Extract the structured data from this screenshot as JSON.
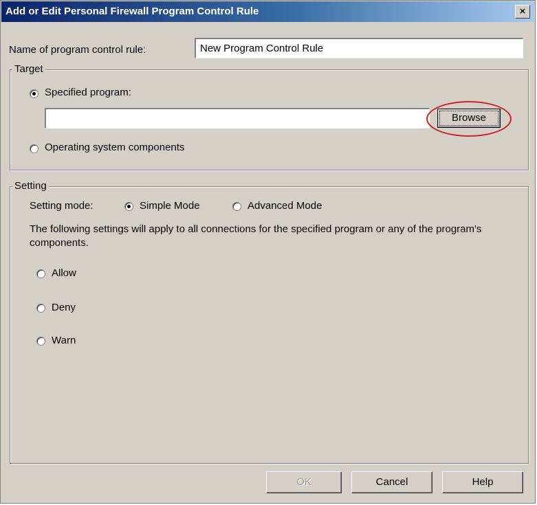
{
  "window": {
    "title": "Add or Edit Personal Firewall Program Control Rule",
    "close_label": "×"
  },
  "name_field": {
    "label": "Name of program control rule:",
    "value": "New Program Control Rule"
  },
  "target": {
    "title": "Target",
    "specified_program_label": "Specified program:",
    "specified_program_selected": true,
    "program_path_value": "",
    "browse_label": "Browse",
    "os_components_label": "Operating system components"
  },
  "setting": {
    "title": "Setting",
    "mode_label": "Setting mode:",
    "simple_mode_label": "Simple Mode",
    "advanced_mode_label": "Advanced Mode",
    "description": "The following settings will apply to all connections for the specified program or any of the program's components.",
    "allow_label": "Allow",
    "deny_label": "Deny",
    "warn_label": "Warn"
  },
  "buttons": {
    "ok_label": "OK",
    "cancel_label": "Cancel",
    "help_label": "Help"
  },
  "colors": {
    "dialog_bg": "#d4d0c8",
    "title_bar": "#0a246a",
    "highlight_ring": "#cc2222"
  }
}
